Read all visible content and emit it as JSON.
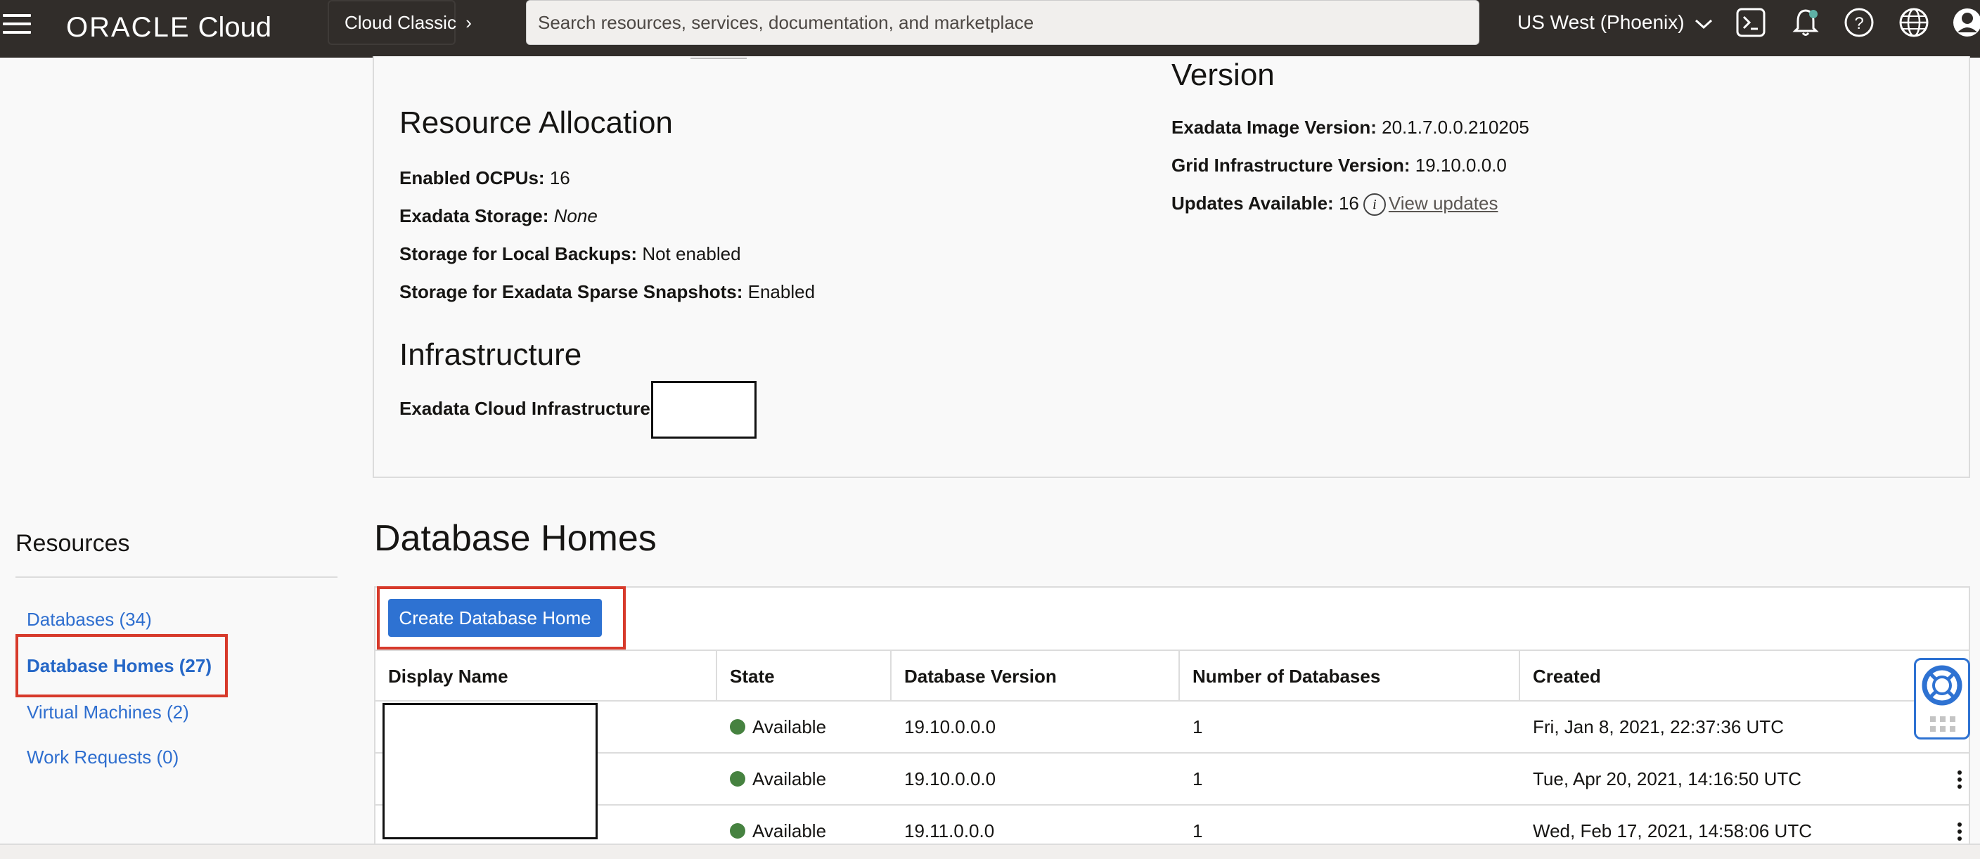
{
  "header": {
    "brand_oracle": "ORACLE",
    "brand_cloud": "Cloud",
    "cloud_classic": "Cloud Classic",
    "search_placeholder": "Search resources, services, documentation, and marketplace",
    "region": "US West (Phoenix)"
  },
  "resource_allocation": {
    "title": "Resource Allocation",
    "enabled_ocpus_label": "Enabled OCPUs:",
    "enabled_ocpus_value": "16",
    "exadata_storage_label": "Exadata Storage:",
    "exadata_storage_value": "None",
    "local_backups_label": "Storage for Local Backups:",
    "local_backups_value": "Not enabled",
    "sparse_snapshots_label": "Storage for Exadata Sparse Snapshots:",
    "sparse_snapshots_value": "Enabled"
  },
  "infrastructure": {
    "title": "Infrastructure",
    "exadata_cloud_label": "Exadata Cloud Infrastructure:"
  },
  "version": {
    "title": "Version",
    "image_version_label": "Exadata Image Version:",
    "image_version_value": "20.1.7.0.0.210205",
    "grid_version_label": "Grid Infrastructure Version:",
    "grid_version_value": "19.10.0.0.0",
    "updates_label": "Updates Available:",
    "updates_value": "16",
    "view_updates": "View updates"
  },
  "resources": {
    "title": "Resources",
    "items": [
      {
        "label": "Databases (34)"
      },
      {
        "label": "Database Homes (27)"
      },
      {
        "label": "Virtual Machines (2)"
      },
      {
        "label": "Work Requests (0)"
      }
    ]
  },
  "database_homes": {
    "title": "Database Homes",
    "create_button": "Create Database Home",
    "columns": [
      "Display Name",
      "State",
      "Database Version",
      "Number of Databases",
      "Created"
    ],
    "rows": [
      {
        "state": "Available",
        "version": "19.10.0.0.0",
        "num_databases": "1",
        "created": "Fri, Jan 8, 2021, 22:37:36 UTC"
      },
      {
        "state": "Available",
        "version": "19.10.0.0.0",
        "num_databases": "1",
        "created": "Tue, Apr 20, 2021, 14:16:50 UTC"
      },
      {
        "state": "Available",
        "version": "19.11.0.0.0",
        "num_databases": "1",
        "created": "Wed, Feb 17, 2021, 14:58:06 UTC"
      }
    ]
  },
  "colors": {
    "topbar": "#312d2a",
    "link": "#2e6ecf",
    "primary_button": "#2e72d2",
    "highlight": "#d73a2b",
    "available": "#468240"
  }
}
